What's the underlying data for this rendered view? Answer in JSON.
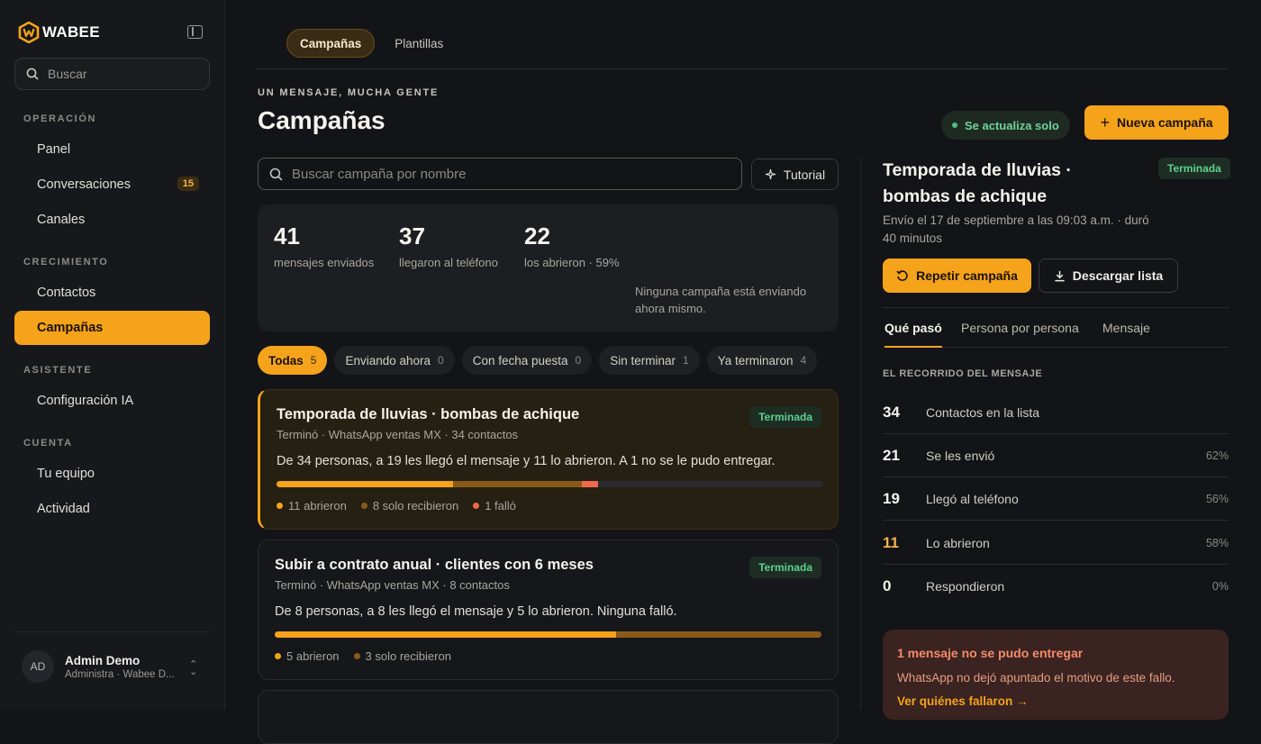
{
  "brand": {
    "name": "WABEE",
    "accent": "#f5a31b"
  },
  "sidebar": {
    "search_placeholder": "Buscar",
    "sections": {
      "operacion": "OPERACIÓN",
      "crecimiento": "CRECIMIENTO",
      "asistente": "ASISTENTE",
      "cuenta": "CUENTA"
    },
    "items": {
      "panel": "Panel",
      "conversaciones": "Conversaciones",
      "conversaciones_badge": "15",
      "canales": "Canales",
      "contactos": "Contactos",
      "campanas": "Campañas",
      "config_ia": "Configuración IA",
      "equipo": "Tu equipo",
      "actividad": "Actividad"
    },
    "user": {
      "initials": "AD",
      "name": "Admin Demo",
      "role": "Administra · Wabee D..."
    }
  },
  "tabs": [
    "Campañas",
    "Plantillas"
  ],
  "header": {
    "kicker": "UN MENSAJE, MUCHA GENTE",
    "title": "Campañas",
    "autorefresh": "Se actualiza solo",
    "new_button": "Nueva campaña"
  },
  "search": {
    "placeholder": "Buscar campaña por nombre",
    "tutorial": "Tutorial"
  },
  "stats": [
    {
      "num": "41",
      "label": "mensajes enviados"
    },
    {
      "num": "37",
      "label": "llegaron al teléfono"
    },
    {
      "num": "22",
      "label": "los abrieron · 59%"
    }
  ],
  "stats_note": "Ninguna campaña está enviando ahora mismo.",
  "filters": [
    {
      "label": "Todas",
      "count": "5"
    },
    {
      "label": "Enviando ahora",
      "count": "0"
    },
    {
      "label": "Con fecha puesta",
      "count": "0"
    },
    {
      "label": "Sin terminar",
      "count": "1"
    },
    {
      "label": "Ya terminaron",
      "count": "4"
    }
  ],
  "campaigns": [
    {
      "title": "Temporada de lluvias · bombas de achique",
      "status": "Terminada",
      "meta": "Terminó · WhatsApp ventas MX · 34 contactos",
      "desc": "De 34 personas, a 19 les llegó el mensaje y 11 lo abrieron. A 1 no se le pudo entregar.",
      "total": 34,
      "opened": 11,
      "received_only": 8,
      "failed": 1,
      "legend": [
        "11 abrieron",
        "8 solo recibieron",
        "1 falló"
      ]
    },
    {
      "title": "Subir a contrato anual · clientes con 6 meses",
      "status": "Terminada",
      "meta": "Terminó · WhatsApp ventas MX · 8 contactos",
      "desc": "De 8 personas, a 8 les llegó el mensaje y 5 lo abrieron. Ninguna falló.",
      "total": 8,
      "opened": 5,
      "received_only": 3,
      "failed": 0,
      "legend": [
        "5 abrieron",
        "3 solo recibieron"
      ]
    }
  ],
  "detail": {
    "title": "Temporada de lluvias · bombas de achique",
    "status": "Terminada",
    "subtitle": "Envío el 17 de septiembre a las 09:03 a.m. · duró 40 minutos",
    "repeat": "Repetir campaña",
    "download": "Descargar lista",
    "tabs": [
      "Qué pasó",
      "Persona por persona",
      "Mensaje"
    ],
    "journey_title": "EL RECORRIDO DEL MENSAJE",
    "journey": [
      {
        "n": "34",
        "label": "Contactos en la lista",
        "pct": ""
      },
      {
        "n": "21",
        "label": "Se les envió",
        "pct": "62%"
      },
      {
        "n": "19",
        "label": "Llegó al teléfono",
        "pct": "56%"
      },
      {
        "n": "11",
        "label": "Lo abrieron",
        "pct": "58%"
      },
      {
        "n": "0",
        "label": "Respondieron",
        "pct": "0%"
      }
    ],
    "fail": {
      "title": "1 mensaje no se pudo entregar",
      "desc": "WhatsApp no dejó apuntado el motivo de este fallo.",
      "link": "Ver quiénes fallaron →"
    }
  }
}
